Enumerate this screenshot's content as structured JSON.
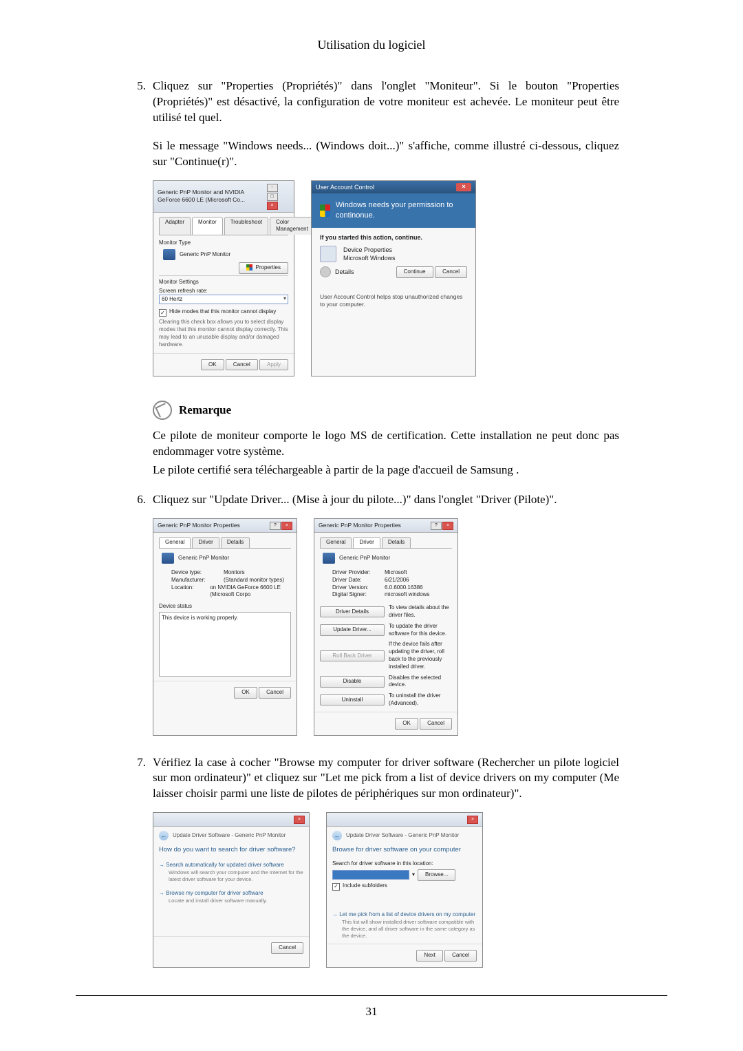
{
  "header": "Utilisation du logiciel",
  "page_number": "31",
  "steps": {
    "s5_num": "5.",
    "s5_t1": "Cliquez sur \"Properties (Propriétés)\" dans l'onglet \"Moniteur\". Si le bouton \"Properties (Propriétés)\" est désactivé, la configuration de votre moniteur est achevée. Le moniteur peut être utilisé tel quel.",
    "s5_t2": "Si le message \"Windows needs... (Windows doit...)\" s'affiche, comme illustré ci-dessous, cliquez sur \"Continue(r)\".",
    "s6_num": "6.",
    "s6_t1": "Cliquez sur \"Update Driver... (Mise à jour du pilote...)\" dans l'onglet \"Driver (Pilote)\".",
    "s7_num": "7.",
    "s7_t1": "Vérifiez la case à cocher \"Browse my computer for driver software (Rechercher un pilote logiciel sur mon ordinateur)\" et cliquez sur \"Let me pick from a list of device drivers on my computer (Me laisser choisir parmi une liste de pilotes de périphériques sur mon ordinateur)\"."
  },
  "remark": {
    "title": "Remarque",
    "p1": "Ce pilote de moniteur comporte le logo MS de certification. Cette installation ne peut donc pas endommager votre système.",
    "p2": "Le pilote certifié sera téléchargeable à partir de la page d'accueil de Samsung ."
  },
  "dlg1": {
    "title": "Generic PnP Monitor and NVIDIA GeForce 6600 LE (Microsoft Co...",
    "tabs": [
      "Adapter",
      "Monitor",
      "Troubleshoot",
      "Color Management"
    ],
    "monitor_type_label": "Monitor Type",
    "monitor_name": "Generic PnP Monitor",
    "properties_btn": "Properties",
    "settings_label": "Monitor Settings",
    "refresh_label": "Screen refresh rate:",
    "refresh_value": "60 Hertz",
    "hide_check": "Hide modes that this monitor cannot display",
    "hide_desc": "Clearing this check box allows you to select display modes that this monitor cannot display correctly. This may lead to an unusable display and/or damaged hardware.",
    "ok": "OK",
    "cancel": "Cancel",
    "apply": "Apply"
  },
  "uac": {
    "title": "User Account Control",
    "headline": "Windows needs your permission to continonue.",
    "started": "If you started this action, continue.",
    "prog_name": "Device Properties",
    "prog_pub": "Microsoft Windows",
    "details": "Details",
    "continue": "Continue",
    "cancel": "Cancel",
    "footer": "User Account Control helps stop unauthorized changes to your computer."
  },
  "dlg3": {
    "title": "Generic PnP Monitor Properties",
    "tabs": [
      "General",
      "Driver",
      "Details"
    ],
    "name": "Generic PnP Monitor",
    "device_type_l": "Device type:",
    "device_type_v": "Monitors",
    "manufacturer_l": "Manufacturer:",
    "manufacturer_v": "(Standard monitor types)",
    "location_l": "Location:",
    "location_v": "on NVIDIA GeForce 6600 LE (Microsoft Corpo",
    "status_l": "Device status",
    "status_v": "This device is working properly.",
    "ok": "OK",
    "cancel": "Cancel"
  },
  "dlg4": {
    "title": "Generic PnP Monitor Properties",
    "tabs": [
      "General",
      "Driver",
      "Details"
    ],
    "name": "Generic PnP Monitor",
    "provider_l": "Driver Provider:",
    "provider_v": "Microsoft",
    "date_l": "Driver Date:",
    "date_v": "6/21/2006",
    "version_l": "Driver Version:",
    "version_v": "6.0.6000.16386",
    "signer_l": "Digital Signer:",
    "signer_v": "microsoft windows",
    "btn_details": "Driver Details",
    "desc_details": "To view details about the driver files.",
    "btn_update": "Update Driver...",
    "desc_update": "To update the driver software for this device.",
    "btn_rollback": "Roll Back Driver",
    "desc_rollback": "If the device fails after updating the driver, roll back to the previously installed driver.",
    "btn_disable": "Disable",
    "desc_disable": "Disables the selected device.",
    "btn_uninstall": "Uninstall",
    "desc_uninstall": "To uninstall the driver (Advanced).",
    "ok": "OK",
    "cancel": "Cancel"
  },
  "wiz1": {
    "crumb": "Update Driver Software - Generic PnP Monitor",
    "question": "How do you want to search for driver software?",
    "opt1": "Search automatically for updated driver software",
    "opt1_sub": "Windows will search your computer and the Internet for the latest driver software for your device.",
    "opt2": "Browse my computer for driver software",
    "opt2_sub": "Locate and install driver software manually.",
    "cancel": "Cancel"
  },
  "wiz2": {
    "crumb": "Update Driver Software - Generic PnP Monitor",
    "heading": "Browse for driver software on your computer",
    "search_label": "Search for driver software in this location:",
    "browse": "Browse...",
    "include": "Include subfolders",
    "pick": "Let me pick from a list of device drivers on my computer",
    "pick_sub": "This list will show installed driver software compatible with the device, and all driver software in the same category as the device.",
    "next": "Next",
    "cancel": "Cancel"
  }
}
